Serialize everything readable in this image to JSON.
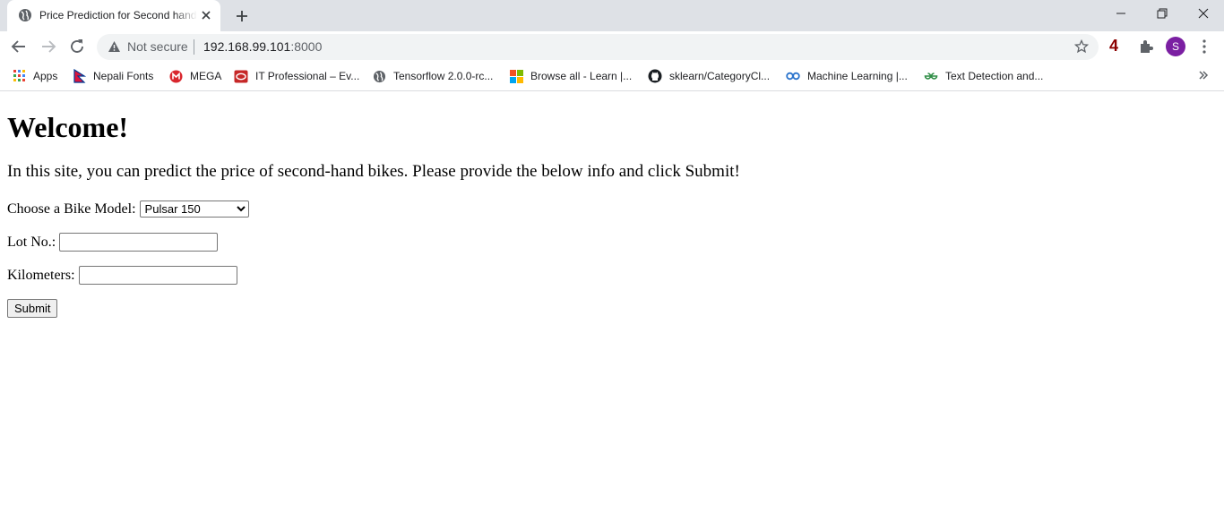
{
  "browser": {
    "tab_title": "Price Prediction for Second hand Bikes",
    "omnibox": {
      "security_label": "Not secure",
      "url_host": "192.168.99.101",
      "url_port": ":8000"
    },
    "extension_badge": "4",
    "profile_initial": "S",
    "bookmarks": [
      {
        "label": "Apps",
        "icon": "apps-grid-icon"
      },
      {
        "label": "Nepali Fonts",
        "icon": "nepal-flag-icon"
      },
      {
        "label": "MEGA",
        "icon": "mega-icon"
      },
      {
        "label": "IT Professional – Ev...",
        "icon": "it-professional-icon"
      },
      {
        "label": "Tensorflow 2.0.0-rc...",
        "icon": "globe-icon"
      },
      {
        "label": "Browse all - Learn |...",
        "icon": "microsoft-icon"
      },
      {
        "label": "sklearn/CategoryCl...",
        "icon": "github-icon"
      },
      {
        "label": "Machine Learning |...",
        "icon": "coursera-icon"
      },
      {
        "label": "Text Detection and...",
        "icon": "geeksforgeeks-icon"
      }
    ],
    "colors": {
      "tabstrip": "#dee1e6",
      "omnibox": "#f1f3f4",
      "avatar": "#7b1fa2",
      "badge": "#8b0000"
    }
  },
  "page": {
    "heading": "Welcome!",
    "intro": "In this site, you can predict the price of second-hand bikes. Please provide the below info and click Submit!",
    "form": {
      "model_label": "Choose a Bike Model:",
      "model_selected": "Pulsar 150",
      "lot_label": "Lot No.:",
      "lot_value": "",
      "km_label": "Kilometers:",
      "km_value": "",
      "submit_label": "Submit"
    }
  }
}
